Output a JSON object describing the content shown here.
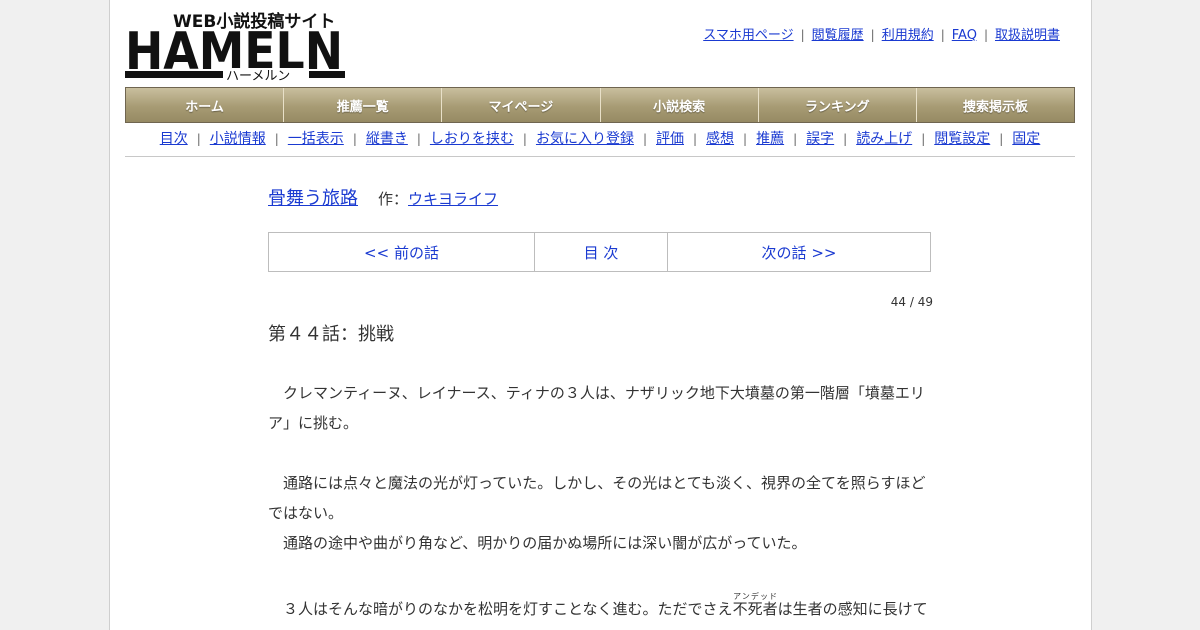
{
  "site": {
    "logo_main": "HAMELN",
    "logo_tagline": "WEB小説投稿サイト",
    "logo_kana": "ハーメルン"
  },
  "top_links": [
    "スマホ用ページ",
    "閲覧履歴",
    "利用規約",
    "FAQ",
    "取扱説明書"
  ],
  "global_nav": [
    "ホーム",
    "推薦一覧",
    "マイページ",
    "小説検索",
    "ランキング",
    "捜索掲示板"
  ],
  "sub_nav": [
    "目次",
    "小説情報",
    "一括表示",
    "縦書き",
    "しおりを挟む",
    "お気に入り登録",
    "評価",
    "感想",
    "推薦",
    "誤字",
    "読み上げ",
    "閲覧設定",
    "固定"
  ],
  "novel": {
    "title": "骨舞う旅路",
    "author_label": "作：",
    "author": "ウキヨライフ"
  },
  "pager": {
    "prev": "<< 前の話",
    "toc": "目 次",
    "next": "次の話 >>"
  },
  "page_count": "44 / 49",
  "chapter": {
    "title": "第４４話：挑戦",
    "paragraph1": "　クレマンティーヌ、レイナース、ティナの３人は、ナザリック地下大墳墓の第一階層「墳墓エリア」に挑む。",
    "paragraph2": "　通路には点々と魔法の光が灯っていた。しかし、その光はとても淡く、視界の全てを照らすほどではない。",
    "paragraph3": "　通路の途中や曲がり角など、明かりの届かぬ場所には深い闇が広がっていた。",
    "paragraph4_before": "　３人はそんな暗がりのなかを松明を灯すことなく進む。ただでさえ",
    "paragraph4_ruby_base": "不死者",
    "paragraph4_ruby_text": "アンデッド",
    "paragraph4_after": "は生者の感知に長けて"
  }
}
